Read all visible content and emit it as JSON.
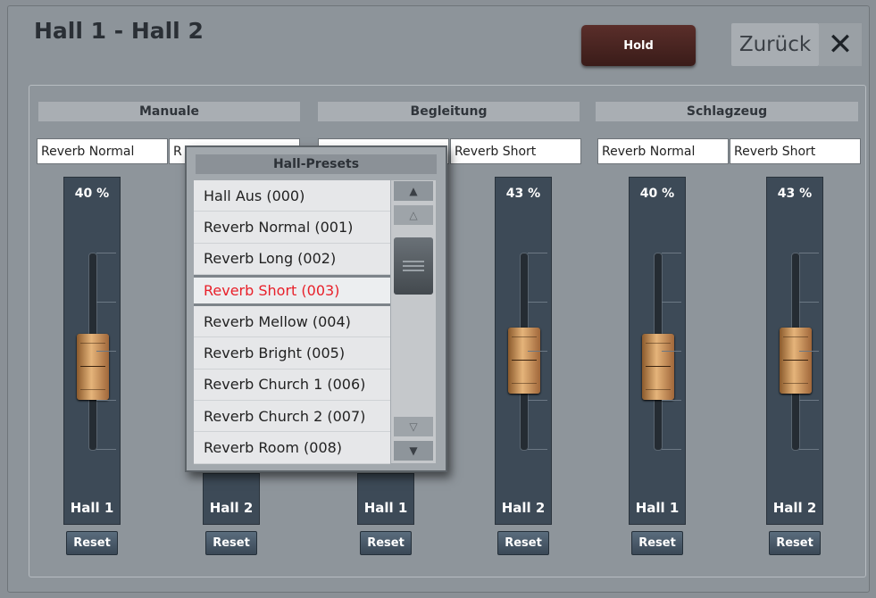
{
  "window": {
    "title": "Hall 1 - Hall 2",
    "hold_label": "Hold",
    "back_label": "Zurück",
    "close_label": "✕"
  },
  "groups": [
    {
      "header": "Manuale",
      "presets": [
        "Reverb Normal",
        "R"
      ]
    },
    {
      "header": "Begleitung",
      "presets": [
        "",
        "Reverb Short"
      ]
    },
    {
      "header": "Schlagzeug",
      "presets": [
        "Reverb Normal",
        "Reverb Short"
      ]
    }
  ],
  "faders": [
    {
      "name": "Hall 1",
      "percent_label": "40 %",
      "value": 40,
      "reset": "Reset"
    },
    {
      "name": "Hall 2",
      "percent_label": "",
      "value": null,
      "reset": "Reset"
    },
    {
      "name": "Hall 1",
      "percent_label": "",
      "value": null,
      "reset": "Reset"
    },
    {
      "name": "Hall 2",
      "percent_label": "43 %",
      "value": 43,
      "reset": "Reset"
    },
    {
      "name": "Hall 1",
      "percent_label": "40 %",
      "value": 40,
      "reset": "Reset"
    },
    {
      "name": "Hall 2",
      "percent_label": "43 %",
      "value": 43,
      "reset": "Reset"
    }
  ],
  "popup": {
    "title": "Hall-Presets",
    "items": [
      "Hall Aus (000)",
      "Reverb Normal (001)",
      "Reverb Long (002)",
      "Reverb Short (003)",
      "Reverb Mellow (004)",
      "Reverb Bright (005)",
      "Reverb Church 1 (006)",
      "Reverb Church 2 (007)",
      "Reverb Room (008)"
    ],
    "selected_index": 3
  },
  "colors": {
    "selected_text": "#e8202a",
    "fader_bg": "#3d4a57",
    "hold_button": "#4a2522"
  }
}
